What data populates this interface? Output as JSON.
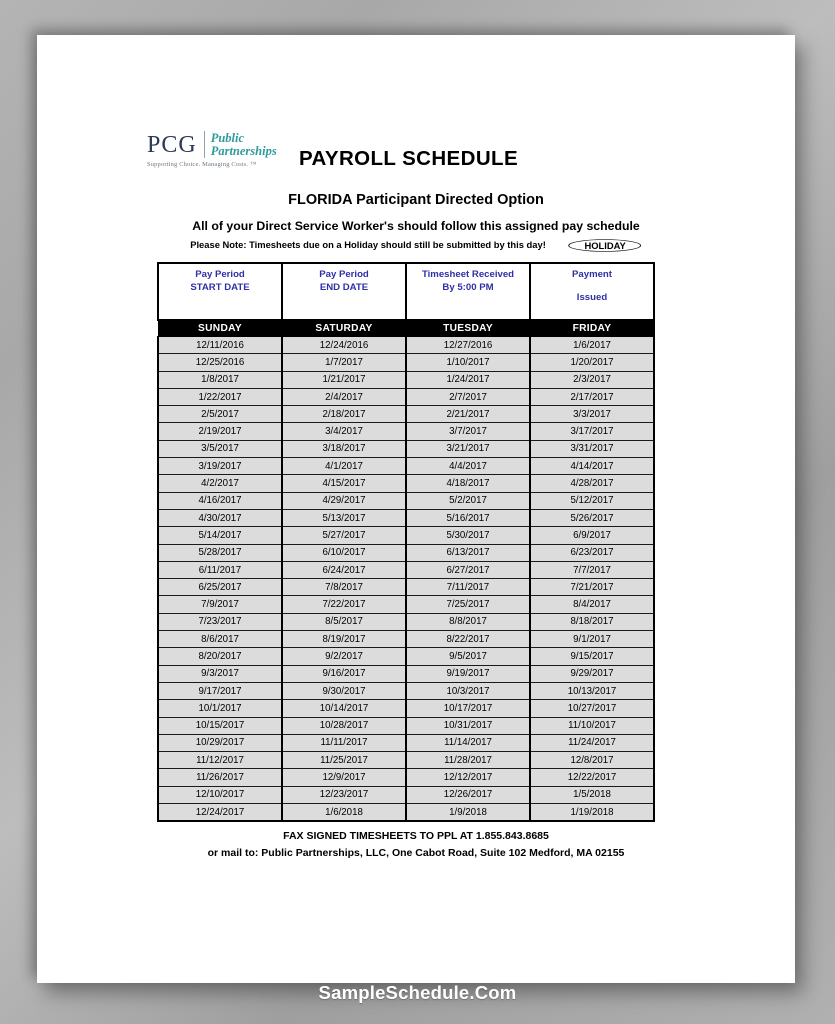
{
  "logo": {
    "mark": "PCG",
    "name_line1": "Public",
    "name_line2": "Partnerships",
    "tagline": "Supporting Choice. Managing Costs. ™"
  },
  "header": {
    "title": "PAYROLL SCHEDULE",
    "subtitle": "FLORIDA Participant Directed Option",
    "instruction": "All of your Direct Service Worker's should follow this assigned pay schedule",
    "note": "Please Note: Timesheets due on a Holiday should still be submitted by this day!",
    "holiday_badge": "HOLIDAY"
  },
  "table": {
    "columns": [
      {
        "label_line1": "Pay Period",
        "label_line2": "START DATE",
        "label_line3": "",
        "day": "SUNDAY"
      },
      {
        "label_line1": "Pay Period",
        "label_line2": "END DATE",
        "label_line3": "",
        "day": "SATURDAY"
      },
      {
        "label_line1": "Timesheet Received",
        "label_line2": "By 5:00 PM",
        "label_line3": "",
        "day": "TUESDAY"
      },
      {
        "label_line1": "Payment",
        "label_line2": "",
        "label_line3": "Issued",
        "day": "FRIDAY"
      }
    ],
    "rows": [
      [
        "12/11/2016",
        "12/24/2016",
        "12/27/2016",
        "1/6/2017"
      ],
      [
        "12/25/2016",
        "1/7/2017",
        "1/10/2017",
        "1/20/2017"
      ],
      [
        "1/8/2017",
        "1/21/2017",
        "1/24/2017",
        "2/3/2017"
      ],
      [
        "1/22/2017",
        "2/4/2017",
        "2/7/2017",
        "2/17/2017"
      ],
      [
        "2/5/2017",
        "2/18/2017",
        "2/21/2017",
        "3/3/2017"
      ],
      [
        "2/19/2017",
        "3/4/2017",
        "3/7/2017",
        "3/17/2017"
      ],
      [
        "3/5/2017",
        "3/18/2017",
        "3/21/2017",
        "3/31/2017"
      ],
      [
        "3/19/2017",
        "4/1/2017",
        "4/4/2017",
        "4/14/2017"
      ],
      [
        "4/2/2017",
        "4/15/2017",
        "4/18/2017",
        "4/28/2017"
      ],
      [
        "4/16/2017",
        "4/29/2017",
        "5/2/2017",
        "5/12/2017"
      ],
      [
        "4/30/2017",
        "5/13/2017",
        "5/16/2017",
        "5/26/2017"
      ],
      [
        "5/14/2017",
        "5/27/2017",
        "5/30/2017",
        "6/9/2017"
      ],
      [
        "5/28/2017",
        "6/10/2017",
        "6/13/2017",
        "6/23/2017"
      ],
      [
        "6/11/2017",
        "6/24/2017",
        "6/27/2017",
        "7/7/2017"
      ],
      [
        "6/25/2017",
        "7/8/2017",
        "7/11/2017",
        "7/21/2017"
      ],
      [
        "7/9/2017",
        "7/22/2017",
        "7/25/2017",
        "8/4/2017"
      ],
      [
        "7/23/2017",
        "8/5/2017",
        "8/8/2017",
        "8/18/2017"
      ],
      [
        "8/6/2017",
        "8/19/2017",
        "8/22/2017",
        "9/1/2017"
      ],
      [
        "8/20/2017",
        "9/2/2017",
        "9/5/2017",
        "9/15/2017"
      ],
      [
        "9/3/2017",
        "9/16/2017",
        "9/19/2017",
        "9/29/2017"
      ],
      [
        "9/17/2017",
        "9/30/2017",
        "10/3/2017",
        "10/13/2017"
      ],
      [
        "10/1/2017",
        "10/14/2017",
        "10/17/2017",
        "10/27/2017"
      ],
      [
        "10/15/2017",
        "10/28/2017",
        "10/31/2017",
        "11/10/2017"
      ],
      [
        "10/29/2017",
        "11/11/2017",
        "11/14/2017",
        "11/24/2017"
      ],
      [
        "11/12/2017",
        "11/25/2017",
        "11/28/2017",
        "12/8/2017"
      ],
      [
        "11/26/2017",
        "12/9/2017",
        "12/12/2017",
        "12/22/2017"
      ],
      [
        "12/10/2017",
        "12/23/2017",
        "12/26/2017",
        "1/5/2018"
      ],
      [
        "12/24/2017",
        "1/6/2018",
        "1/9/2018",
        "1/19/2018"
      ]
    ]
  },
  "footer": {
    "line1": "FAX SIGNED TIMESHEETS TO PPL AT 1.855.843.8685",
    "line2": "or mail to: Public Partnerships, LLC, One Cabot Road, Suite 102 Medford, MA 02155"
  },
  "watermark": {
    "text": "SampleSchedule.Com"
  },
  "colors": {
    "header_blue": "#2f2fa8",
    "day_band": "#000000",
    "row_fill": "#dcdcdc",
    "logo_navy": "#2b3a55",
    "logo_teal": "#2e9c9c"
  }
}
